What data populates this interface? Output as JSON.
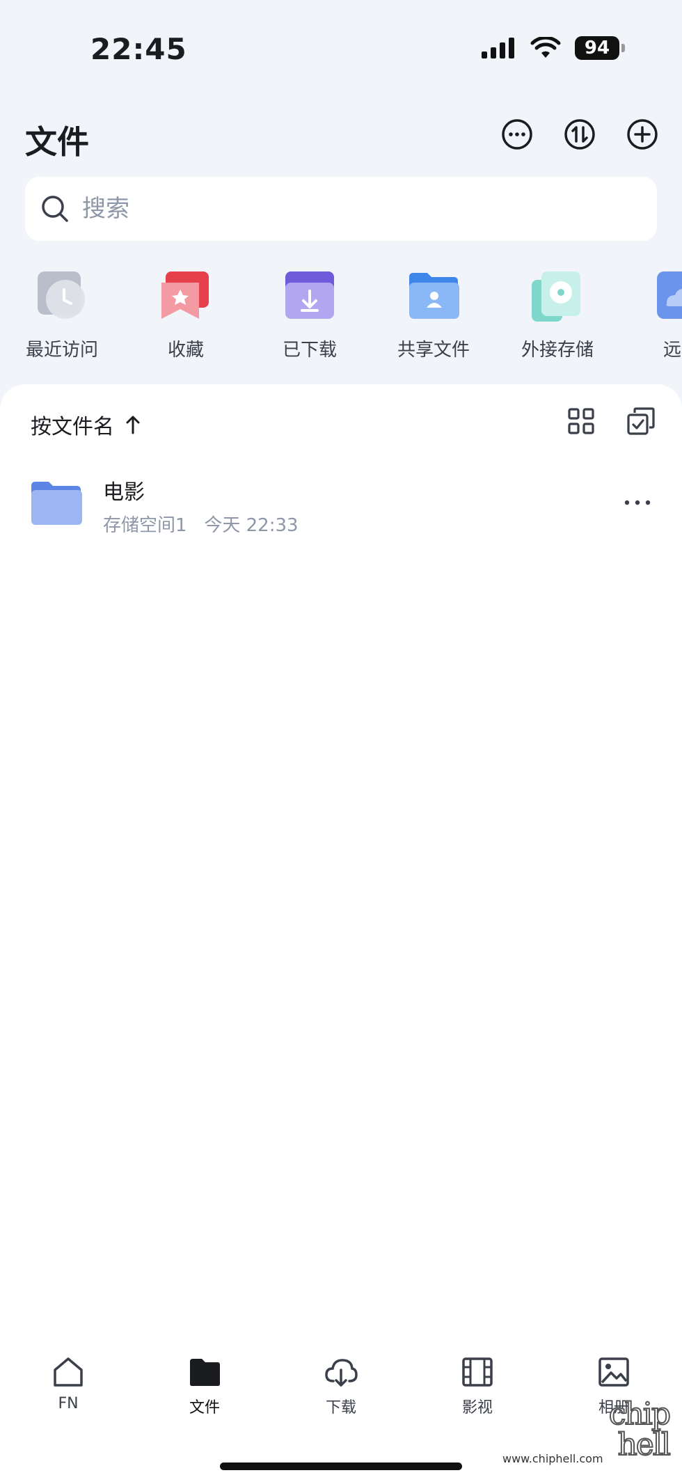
{
  "status": {
    "time": "22:45",
    "battery": "94"
  },
  "header": {
    "title": "文件"
  },
  "search": {
    "placeholder": "搜索"
  },
  "quick_access": [
    {
      "label": "最近访问",
      "icon": "clock-icon"
    },
    {
      "label": "收藏",
      "icon": "star-bookmark-icon"
    },
    {
      "label": "已下载",
      "icon": "download-folder-icon"
    },
    {
      "label": "共享文件",
      "icon": "shared-folder-icon"
    },
    {
      "label": "外接存储",
      "icon": "external-disk-icon"
    },
    {
      "label": "远程",
      "icon": "cloud-icon"
    }
  ],
  "sort": {
    "label": "按文件名"
  },
  "files": [
    {
      "name": "电影",
      "location": "存储空间1",
      "date": "今天",
      "time": "22:33"
    }
  ],
  "tabs": [
    {
      "label": "FN",
      "icon": "home-icon"
    },
    {
      "label": "文件",
      "icon": "folder-icon",
      "active": true
    },
    {
      "label": "下载",
      "icon": "cloud-download-icon"
    },
    {
      "label": "影视",
      "icon": "film-icon"
    },
    {
      "label": "相册",
      "icon": "image-icon"
    }
  ],
  "watermark": {
    "text": "www.chiphell.com",
    "logo": "chip hell"
  },
  "colors": {
    "background": "#f1f4f9",
    "accent_folder": "#8fa8f0",
    "muted_text": "#8e97a8"
  }
}
